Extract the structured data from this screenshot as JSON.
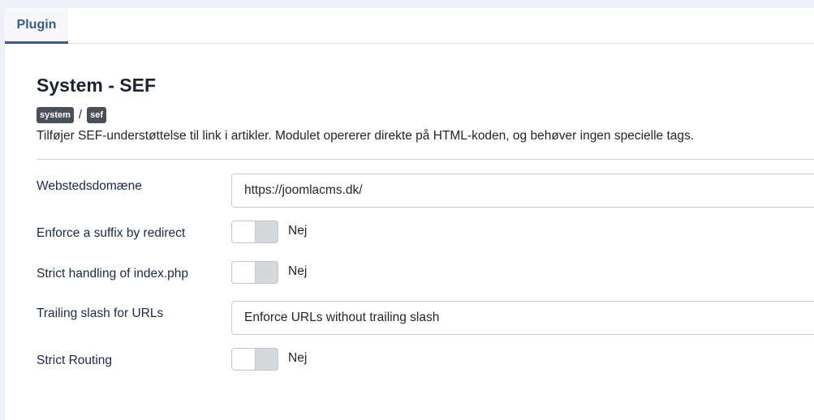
{
  "tabs": [
    {
      "label": "Plugin",
      "active": true
    }
  ],
  "plugin": {
    "title": "System - SEF",
    "badges": [
      "system",
      "sef"
    ],
    "separator": "/",
    "description": "Tilføjer SEF-understøttelse til link i artikler. Modulet opererer direkte på HTML-koden, og behøver ingen specielle tags."
  },
  "fields": {
    "domain": {
      "label": "Webstedsdomæne",
      "value": "https://joomlacms.dk/"
    },
    "suffix": {
      "label": "Enforce a suffix by redirect",
      "state": "Nej"
    },
    "indexphp": {
      "label": "Strict handling of index.php",
      "state": "Nej"
    },
    "trailing": {
      "label": "Trailing slash for URLs",
      "value": "Enforce URLs without trailing slash"
    },
    "routing": {
      "label": "Strict Routing",
      "state": "Nej"
    }
  },
  "colors": {
    "accent": "#3f5c80",
    "badge": "#495057"
  }
}
